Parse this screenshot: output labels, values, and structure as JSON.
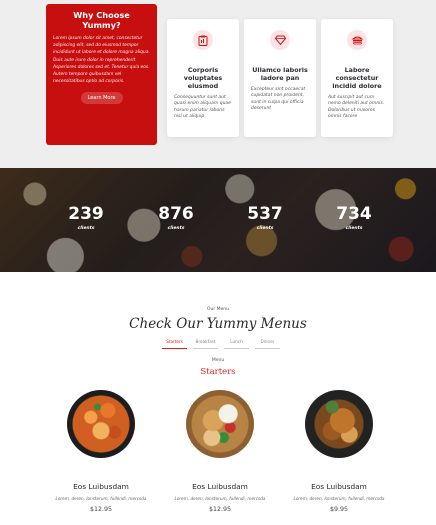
{
  "why": {
    "title": "Why Choose Yummy?",
    "text": "Lorem ipsum dolor sit amet, consectetur adipiscing elit, sed do eiusmod tempor incididunt ut labore et dolore magna aliqua. Duis aute irure dolor in reprehenderit Asperiores dolores sed et. Tenetur quia eos. Autem tempore quibusdam vel necessitatibus optio ad corporis.",
    "button_label": "Learn More"
  },
  "cards": [
    {
      "icon": "clipboard-icon",
      "title": "Corporis voluptates eiusmod",
      "text": "Consequuntur sunt aut quasi enim aliquam quae harum pariatur laboris nisi ut aliquip"
    },
    {
      "icon": "gem-icon",
      "title": "Ullamco laboris ladore pan",
      "text": "Excepteur sint occaecat cupidatat non proident, sunt in culpa qui officia deserunt"
    },
    {
      "icon": "inbox-icon",
      "title": "Labore consectetur incidid dolore",
      "text": "Aut suscipit aut cum nemo deleniti aut omnis. Doloribus ut maiores omnis facere"
    }
  ],
  "stats": [
    {
      "value": "239",
      "label": "clients"
    },
    {
      "value": "876",
      "label": "clients"
    },
    {
      "value": "537",
      "label": "clients"
    },
    {
      "value": "734",
      "label": "clients"
    }
  ],
  "menu": {
    "eyebrow": "Our Menu",
    "title": "Check Our Yummy Menus",
    "tabs": [
      "Starters",
      "Breakfast",
      "Lunch",
      "Dinner"
    ],
    "sub": "Menu",
    "category": "Starters",
    "dishes": [
      {
        "name": "Eos Luibusdam",
        "ingredients": "Lorem, deren, lonsterum, fullendi, mercsda",
        "price": "$12.95"
      },
      {
        "name": "Eos Luibusdam",
        "ingredients": "Lorem, deren, lonsterum, fullendi, mercsda",
        "price": "$12.95"
      },
      {
        "name": "Eos Luibusdam",
        "ingredients": "Lorem, deren, lonsterum, fullendi, mercsda",
        "price": "$9.95"
      }
    ]
  },
  "colors": {
    "accent": "#ce1212",
    "background": "#eeeeee"
  }
}
